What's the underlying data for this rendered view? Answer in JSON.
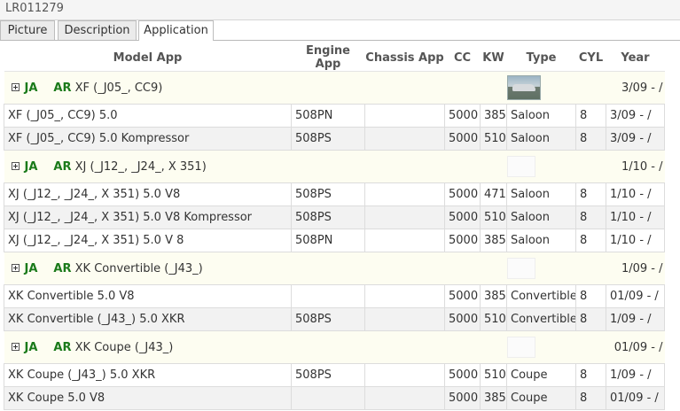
{
  "part_number": "LR011279",
  "tabs": [
    {
      "label": "Picture",
      "active": false
    },
    {
      "label": "Description",
      "active": false
    },
    {
      "label": "Application",
      "active": true
    }
  ],
  "columns": [
    "Model App",
    "Engine App",
    "Chassis App",
    "CC",
    "KW",
    "Type",
    "CYL",
    "Year"
  ],
  "groups": [
    {
      "brand_a": "JA",
      "brand_b": "AR",
      "model": "XF (_J05_, CC9)",
      "image": "car-photo",
      "year": "3/09 - /",
      "rows": [
        {
          "model": "XF (_J05_, CC9) 5.0",
          "engine": "508PN",
          "chassis": "",
          "cc": "5000",
          "kw": "385",
          "type": "Saloon",
          "cyl": "8",
          "year": "3/09 - /"
        },
        {
          "model": "XF (_J05_, CC9) 5.0 Kompressor",
          "engine": "508PS",
          "chassis": "",
          "cc": "5000",
          "kw": "510",
          "type": "Saloon",
          "cyl": "8",
          "year": "3/09 - /"
        }
      ]
    },
    {
      "brand_a": "JA",
      "brand_b": "AR",
      "model": "XJ (_J12_, _J24_, X 351)",
      "image": "no-image-placeholder",
      "year": "1/10 - /",
      "rows": [
        {
          "model": "XJ (_J12_, _J24_, X 351) 5.0 V8",
          "engine": "508PS",
          "chassis": "",
          "cc": "5000",
          "kw": "471",
          "type": "Saloon",
          "cyl": "8",
          "year": "1/10 - /"
        },
        {
          "model": "XJ (_J12_, _J24_, X 351) 5.0 V8 Kompressor",
          "engine": "508PS",
          "chassis": "",
          "cc": "5000",
          "kw": "510",
          "type": "Saloon",
          "cyl": "8",
          "year": "1/10 - /"
        },
        {
          "model": "XJ (_J12_, _J24_, X 351) 5.0 V 8",
          "engine": "508PN",
          "chassis": "",
          "cc": "5000",
          "kw": "385",
          "type": "Saloon",
          "cyl": "8",
          "year": "1/10 - /"
        }
      ]
    },
    {
      "brand_a": "JA",
      "brand_b": "AR",
      "model": "XK Convertible (_J43_)",
      "image": "no-image-placeholder",
      "year": "1/09 - /",
      "rows": [
        {
          "model": "XK Convertible 5.0 V8",
          "engine": "",
          "chassis": "",
          "cc": "5000",
          "kw": "385",
          "type": "Convertible",
          "cyl": "8",
          "year": "01/09 - /"
        },
        {
          "model": "XK Convertible (_J43_) 5.0 XKR",
          "engine": "508PS",
          "chassis": "",
          "cc": "5000",
          "kw": "510",
          "type": "Convertible",
          "cyl": "8",
          "year": "1/09 - /"
        }
      ]
    },
    {
      "brand_a": "JA",
      "brand_b": "AR",
      "model": "XK Coupe (_J43_)",
      "image": "no-image-placeholder",
      "year": "01/09 - /",
      "rows": [
        {
          "model": "XK Coupe (_J43_) 5.0 XKR",
          "engine": "508PS",
          "chassis": "",
          "cc": "5000",
          "kw": "510",
          "type": "Coupe",
          "cyl": "8",
          "year": "1/09 - /"
        },
        {
          "model": "XK Coupe 5.0 V8",
          "engine": "",
          "chassis": "",
          "cc": "5000",
          "kw": "385",
          "type": "Coupe",
          "cyl": "8",
          "year": "01/09 - /"
        }
      ]
    }
  ]
}
